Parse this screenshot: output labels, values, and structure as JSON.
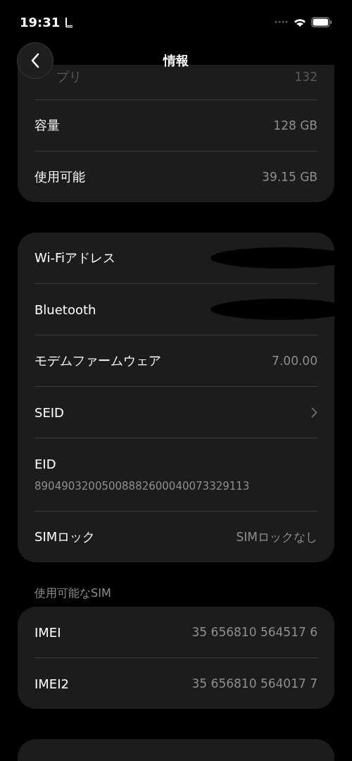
{
  "status_bar": {
    "time": "19:31"
  },
  "header": {
    "title": "情報"
  },
  "cards": [
    {
      "kind": "list",
      "rows": [
        {
          "kind": "value",
          "label": "プリ",
          "value": "132",
          "faded": true
        },
        {
          "kind": "value",
          "label": "容量",
          "value": "128 GB",
          "faded": false
        },
        {
          "kind": "value",
          "label": "使用可能",
          "value": "39.15 GB",
          "faded": false
        }
      ]
    },
    {
      "kind": "list",
      "rows": [
        {
          "kind": "redacted",
          "label": "Wi-Fiアドレス",
          "faded": false
        },
        {
          "kind": "redacted",
          "label": "Bluetooth",
          "faded": false
        },
        {
          "kind": "value",
          "label": "モデムファームウェア",
          "value": "7.00.00",
          "faded": false
        },
        {
          "kind": "link",
          "label": "SEID",
          "faded": false
        },
        {
          "kind": "stacked",
          "label": "EID",
          "value": "89049032005008882600040073329113",
          "faded": false
        },
        {
          "kind": "value",
          "label": "SIMロック",
          "value": "SIMロックなし",
          "faded": false
        }
      ]
    },
    {
      "kind": "list",
      "header": "使用可能なSIM",
      "rows": [
        {
          "kind": "value",
          "label": "IMEI",
          "value": "35 656810 564517 6",
          "faded": false
        },
        {
          "kind": "value",
          "label": "IMEI2",
          "value": "35 656810 564017 7",
          "faded": false
        }
      ]
    },
    {
      "kind": "empty"
    }
  ]
}
